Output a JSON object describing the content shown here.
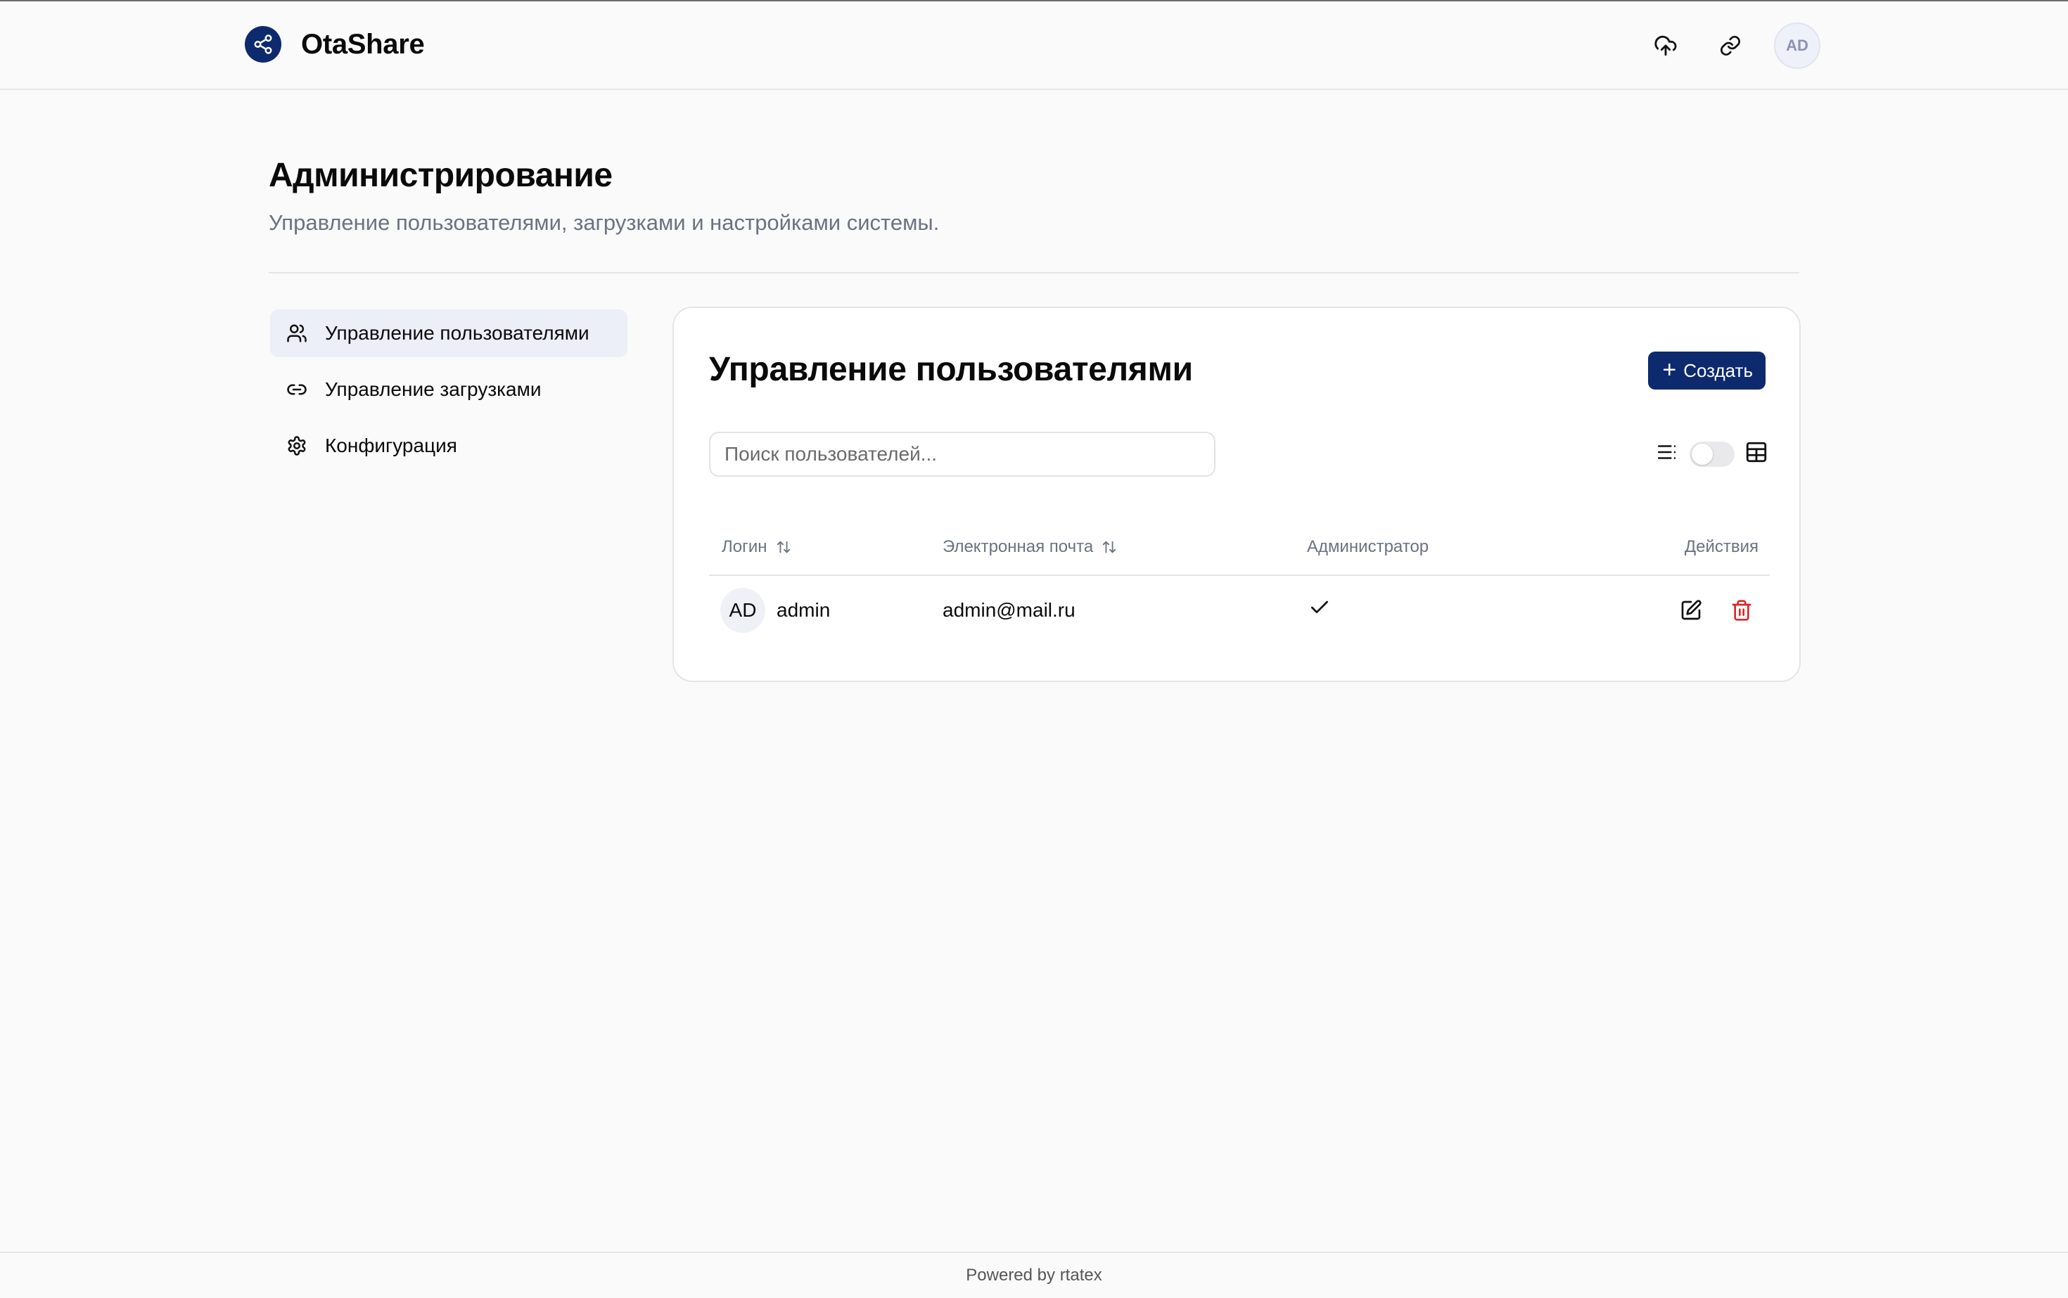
{
  "app": {
    "name": "OtaShare",
    "accent": "#0d2a6e",
    "user_initials": "AD"
  },
  "header": {
    "icons": [
      "upload-cloud-icon",
      "link-icon"
    ]
  },
  "page": {
    "title": "Администрирование",
    "subtitle": "Управление пользователями, загрузками и настройками системы."
  },
  "sidebar": {
    "items": [
      {
        "label": "Управление пользователями",
        "icon": "users-icon",
        "active": true
      },
      {
        "label": "Управление загрузками",
        "icon": "link-icon",
        "active": false
      },
      {
        "label": "Конфигурация",
        "icon": "gear-icon",
        "active": false
      }
    ]
  },
  "users_panel": {
    "title": "Управление пользователями",
    "create_label": "Создать",
    "search_placeholder": "Поиск пользователей...",
    "search_value": "",
    "view_mode": "list",
    "columns": {
      "login": "Логин",
      "email": "Электронная почта",
      "admin": "Администратор",
      "actions": "Действия"
    },
    "rows": [
      {
        "initials": "AD",
        "login": "admin",
        "email": "admin@mail.ru",
        "is_admin": true
      }
    ]
  },
  "footer": {
    "text": "Powered by rtatex"
  },
  "colors": {
    "delete": "#dc2626",
    "muted_text": "#6b7280"
  }
}
